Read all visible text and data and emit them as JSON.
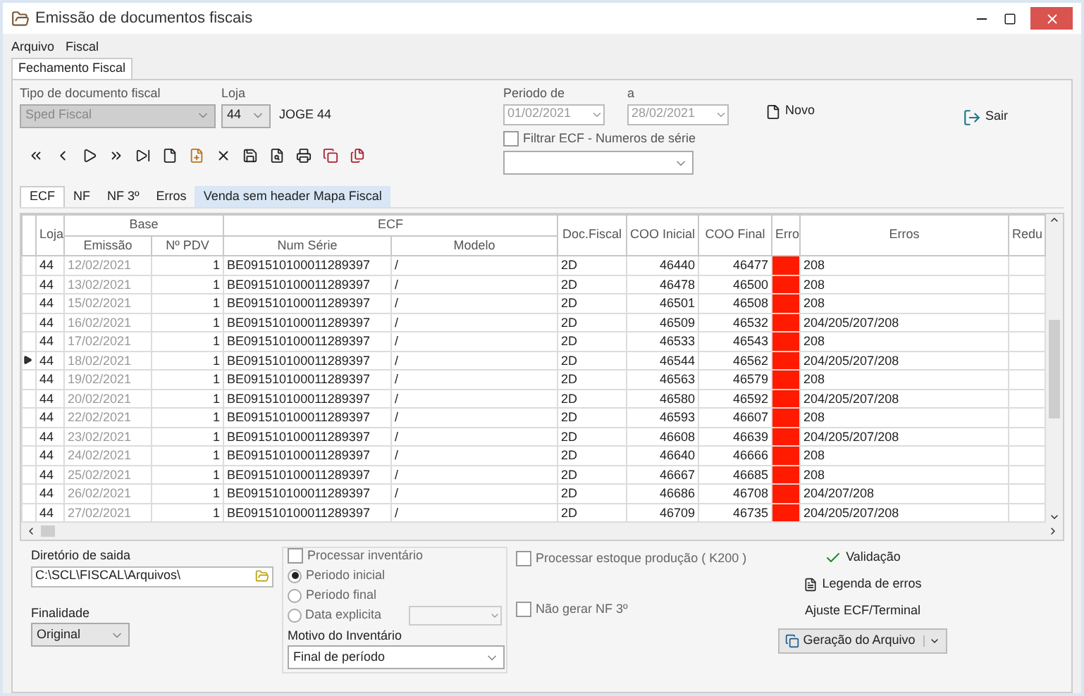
{
  "window": {
    "title": "Emissão de documentos fiscais"
  },
  "menu": [
    "Arquivo",
    "Fiscal"
  ],
  "main_tabs": [
    {
      "label": "Fechamento Fiscal",
      "selected": true
    }
  ],
  "filters": {
    "tipo": {
      "label": "Tipo de documento fiscal",
      "value": "Sped Fiscal",
      "disabled": true
    },
    "loja": {
      "label": "Loja",
      "value": "44",
      "name": "JOGE 44"
    },
    "periodo_de": {
      "label": "Periodo  de",
      "value": "01/02/2021"
    },
    "periodo_a": {
      "label": "a",
      "value": "28/02/2021"
    },
    "filtrar_ecf": {
      "label": "Filtrar ECF - Numeros de  série",
      "checked": false
    },
    "novo": "Novo",
    "sair": "Sair"
  },
  "sub_tabs": [
    {
      "label": "ECF",
      "selected": true,
      "highlighted": false
    },
    {
      "label": "NF",
      "selected": false,
      "highlighted": false
    },
    {
      "label": "NF 3º",
      "selected": false,
      "highlighted": false
    },
    {
      "label": "Erros",
      "selected": false,
      "highlighted": false
    },
    {
      "label": "Venda sem header Mapa Fiscal",
      "selected": false,
      "highlighted": true
    }
  ],
  "table": {
    "groups": [
      "Base",
      "ECF"
    ],
    "columns": [
      "Loja",
      "Emissão",
      "Nº PDV",
      "Num Série",
      "Modelo",
      "Doc.Fiscal",
      "COO Inicial",
      "COO Final",
      "Erro",
      "Erros",
      "Redu"
    ],
    "rows": [
      {
        "loja": "44",
        "emissao": "12/02/2021",
        "pdv": "1",
        "serie": "BE091510100011289397",
        "modelo": "/",
        "doc": "2D",
        "coo_ini": "46440",
        "coo_fim": "46477",
        "error": true,
        "erros": "208",
        "selected": false
      },
      {
        "loja": "44",
        "emissao": "13/02/2021",
        "pdv": "1",
        "serie": "BE091510100011289397",
        "modelo": "/",
        "doc": "2D",
        "coo_ini": "46478",
        "coo_fim": "46500",
        "error": true,
        "erros": "208",
        "selected": false
      },
      {
        "loja": "44",
        "emissao": "15/02/2021",
        "pdv": "1",
        "serie": "BE091510100011289397",
        "modelo": "/",
        "doc": "2D",
        "coo_ini": "46501",
        "coo_fim": "46508",
        "error": true,
        "erros": "208",
        "selected": false
      },
      {
        "loja": "44",
        "emissao": "16/02/2021",
        "pdv": "1",
        "serie": "BE091510100011289397",
        "modelo": "/",
        "doc": "2D",
        "coo_ini": "46509",
        "coo_fim": "46532",
        "error": true,
        "erros": "204/205/207/208",
        "selected": false
      },
      {
        "loja": "44",
        "emissao": "17/02/2021",
        "pdv": "1",
        "serie": "BE091510100011289397",
        "modelo": "/",
        "doc": "2D",
        "coo_ini": "46533",
        "coo_fim": "46543",
        "error": true,
        "erros": "208",
        "selected": false
      },
      {
        "loja": "44",
        "emissao": "18/02/2021",
        "pdv": "1",
        "serie": "BE091510100011289397",
        "modelo": "/",
        "doc": "2D",
        "coo_ini": "46544",
        "coo_fim": "46562",
        "error": true,
        "erros": "204/205/207/208",
        "selected": true
      },
      {
        "loja": "44",
        "emissao": "19/02/2021",
        "pdv": "1",
        "serie": "BE091510100011289397",
        "modelo": "/",
        "doc": "2D",
        "coo_ini": "46563",
        "coo_fim": "46579",
        "error": true,
        "erros": "208",
        "selected": false
      },
      {
        "loja": "44",
        "emissao": "20/02/2021",
        "pdv": "1",
        "serie": "BE091510100011289397",
        "modelo": "/",
        "doc": "2D",
        "coo_ini": "46580",
        "coo_fim": "46592",
        "error": true,
        "erros": "204/205/207/208",
        "selected": false
      },
      {
        "loja": "44",
        "emissao": "22/02/2021",
        "pdv": "1",
        "serie": "BE091510100011289397",
        "modelo": "/",
        "doc": "2D",
        "coo_ini": "46593",
        "coo_fim": "46607",
        "error": true,
        "erros": "208",
        "selected": false
      },
      {
        "loja": "44",
        "emissao": "23/02/2021",
        "pdv": "1",
        "serie": "BE091510100011289397",
        "modelo": "/",
        "doc": "2D",
        "coo_ini": "46608",
        "coo_fim": "46639",
        "error": true,
        "erros": "204/205/207/208",
        "selected": false
      },
      {
        "loja": "44",
        "emissao": "24/02/2021",
        "pdv": "1",
        "serie": "BE091510100011289397",
        "modelo": "/",
        "doc": "2D",
        "coo_ini": "46640",
        "coo_fim": "46666",
        "error": true,
        "erros": "208",
        "selected": false
      },
      {
        "loja": "44",
        "emissao": "25/02/2021",
        "pdv": "1",
        "serie": "BE091510100011289397",
        "modelo": "/",
        "doc": "2D",
        "coo_ini": "46667",
        "coo_fim": "46685",
        "error": true,
        "erros": "208",
        "selected": false
      },
      {
        "loja": "44",
        "emissao": "26/02/2021",
        "pdv": "1",
        "serie": "BE091510100011289397",
        "modelo": "/",
        "doc": "2D",
        "coo_ini": "46686",
        "coo_fim": "46708",
        "error": true,
        "erros": "204/207/208",
        "selected": false
      },
      {
        "loja": "44",
        "emissao": "27/02/2021",
        "pdv": "1",
        "serie": "BE091510100011289397",
        "modelo": "/",
        "doc": "2D",
        "coo_ini": "46709",
        "coo_fim": "46735",
        "error": true,
        "erros": "204/205/207/208",
        "selected": false
      }
    ]
  },
  "output": {
    "dir_label": "Diretório de saida",
    "dir_value": "C:\\SCL\\FISCAL\\Arquivos\\",
    "finalidade_label": "Finalidade",
    "finalidade_value": "Original"
  },
  "inventario": {
    "label": "Processar inventário",
    "checked": false,
    "options": [
      {
        "label": "Periodo inicial",
        "selected": true
      },
      {
        "label": "Periodo final",
        "selected": false
      },
      {
        "label": "Data explicita",
        "selected": false
      }
    ],
    "motivo_label": "Motivo do Inventário",
    "motivo_value": "Final de período"
  },
  "checks": [
    {
      "label": "Processar estoque produção ( K200 )",
      "checked": false
    },
    {
      "label": "Não gerar NF 3º",
      "checked": false
    }
  ],
  "actions": {
    "validacao": "Validação",
    "legenda": "Legenda de erros",
    "ajuste": "Ajuste ECF/Terminal",
    "geracao": "Geração do Arquivo"
  }
}
